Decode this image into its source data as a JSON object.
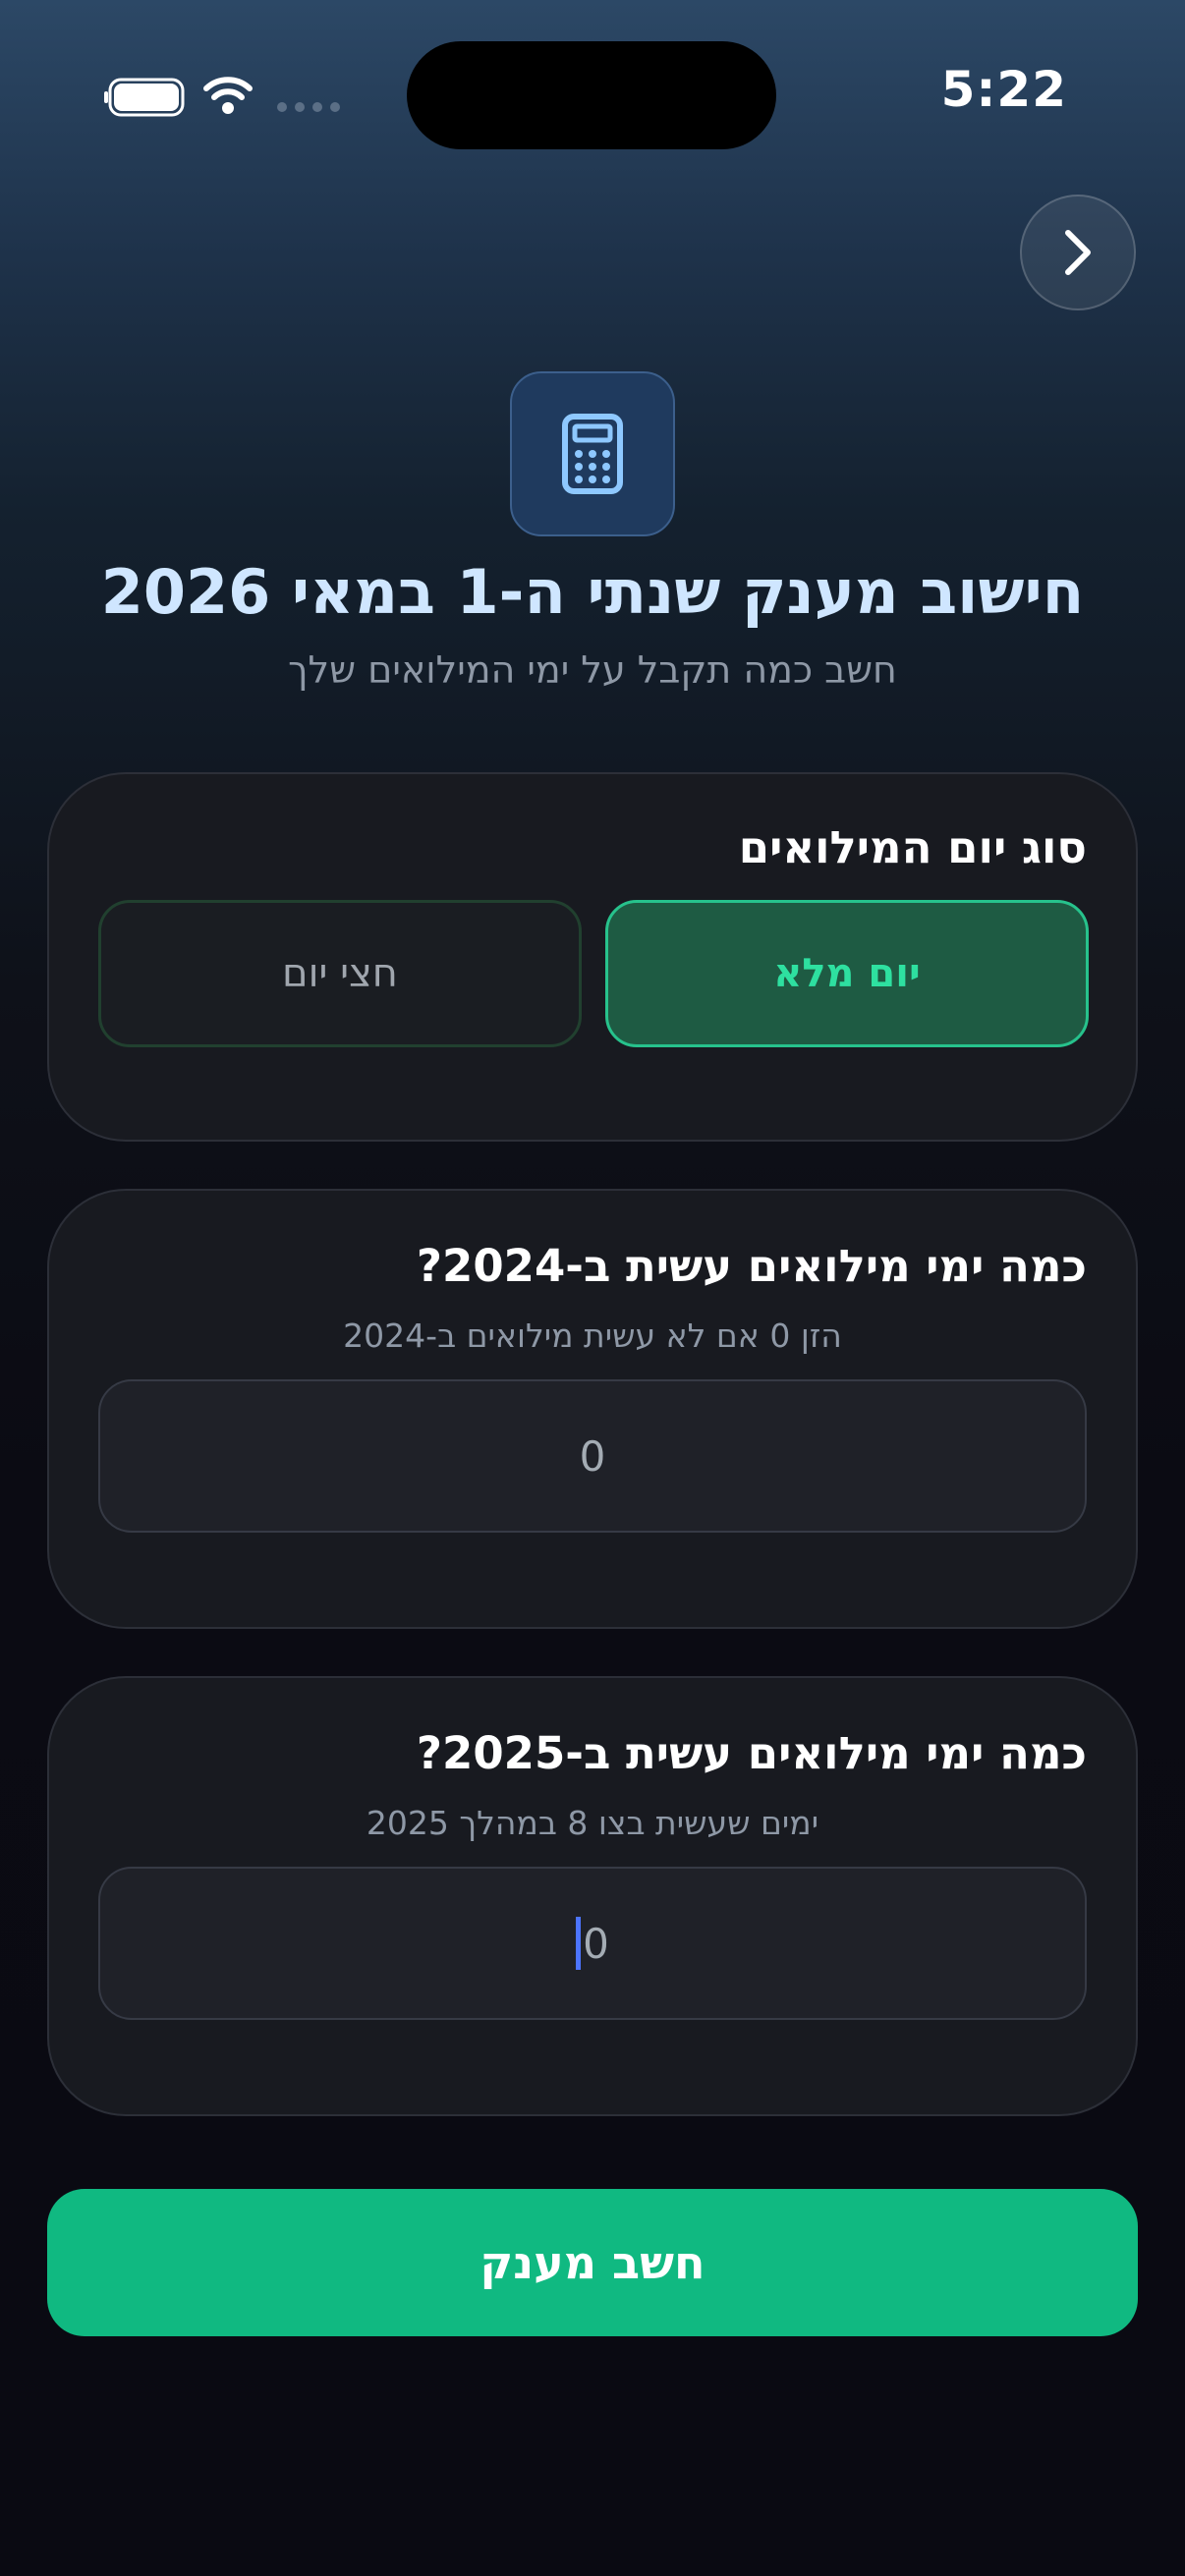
{
  "status_bar": {
    "time": "5:22"
  },
  "header": {
    "title": "חישוב מענק שנתי ה-1 במאי 2026",
    "subtitle": "חשב כמה תקבל על ימי המילואים שלך"
  },
  "day_type": {
    "title": "סוג יום המילואים",
    "options": [
      {
        "label": "יום מלא",
        "selected": true
      },
      {
        "label": "חצי יום",
        "selected": false
      }
    ]
  },
  "days_2024": {
    "title": "כמה ימי מילואים עשית ב-2024?",
    "hint": "הזן 0 אם לא עשית מילואים ב-2024",
    "value": "0"
  },
  "days_2025": {
    "title": "כמה ימי מילואים עשית ב-2025?",
    "hint": "ימים שעשית בצו 8 במהלך 2025",
    "value": "0"
  },
  "submit_label": "חשב מענק",
  "colors": {
    "accent": "#10b981",
    "selected_text": "#2ee0a0",
    "title": "#cfe6ff"
  }
}
